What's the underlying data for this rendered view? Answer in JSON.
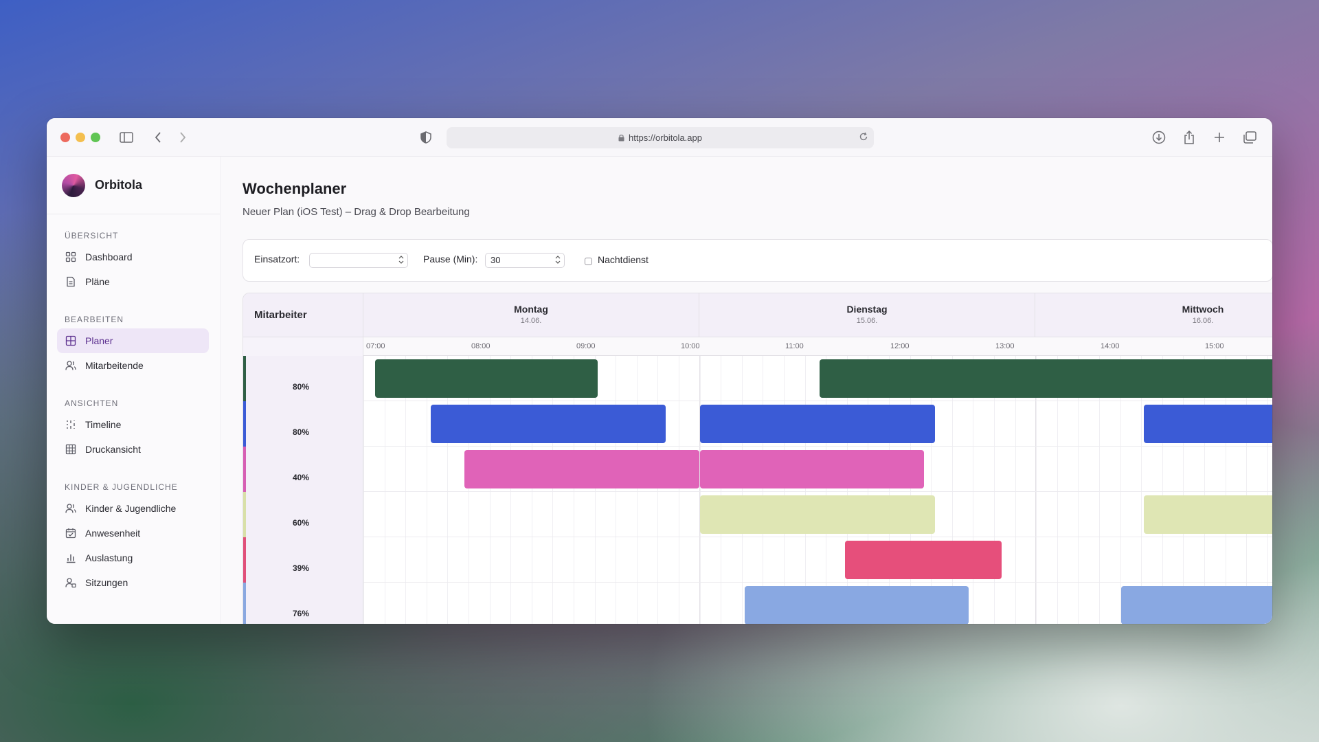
{
  "browser": {
    "url": "https://orbitola.app"
  },
  "brand": {
    "name": "Orbitola"
  },
  "sidebar": {
    "sections": [
      {
        "label": "ÜBERSICHT",
        "items": [
          {
            "label": "Dashboard",
            "icon": "grid-icon"
          },
          {
            "label": "Pläne",
            "icon": "document-icon"
          }
        ]
      },
      {
        "label": "BEARBEITEN",
        "items": [
          {
            "label": "Planer",
            "icon": "grid-icon",
            "active": true
          },
          {
            "label": "Mitarbeitende",
            "icon": "users-icon"
          }
        ]
      },
      {
        "label": "ANSICHTEN",
        "items": [
          {
            "label": "Timeline",
            "icon": "timeline-icon"
          },
          {
            "label": "Druckansicht",
            "icon": "table-icon"
          }
        ]
      },
      {
        "label": "KINDER & JUGENDLICHE",
        "items": [
          {
            "label": "Kinder & Jugendliche",
            "icon": "users-icon"
          },
          {
            "label": "Anwesenheit",
            "icon": "calendar-check-icon"
          },
          {
            "label": "Auslastung",
            "icon": "bar-chart-icon"
          },
          {
            "label": "Sitzungen",
            "icon": "user-session-icon"
          }
        ]
      }
    ]
  },
  "page": {
    "title": "Wochenplaner",
    "subtitle": "Neuer Plan (iOS Test) – Drag & Drop Bearbeitung"
  },
  "filters": {
    "einsatzort_label": "Einsatzort:",
    "einsatzort_value": "",
    "pause_label": "Pause (Min):",
    "pause_value": "30",
    "nachtdienst_label": "Nachtdienst"
  },
  "grid": {
    "header_label": "Mitarbeiter",
    "days": [
      {
        "name": "Montag",
        "date": "14.06."
      },
      {
        "name": "Dienstag",
        "date": "15.06."
      },
      {
        "name": "Mittwoch",
        "date": "16.06."
      }
    ],
    "times": [
      "07:00",
      "08:00",
      "09:00",
      "10:00",
      "11:00",
      "12:00",
      "13:00",
      "14:00",
      "15:00"
    ],
    "employees": [
      {
        "name": "",
        "hours": "",
        "percent": "80%",
        "color": "#2f5f45"
      },
      {
        "name": "",
        "hours": "",
        "percent": "80%",
        "color": "#3b5bd6"
      },
      {
        "name": "",
        "hours": "",
        "percent": "40%",
        "color": "#d65fb4"
      },
      {
        "name": "",
        "hours": "",
        "percent": "60%",
        "color": "#d8e0a8"
      },
      {
        "name": "",
        "hours": "",
        "percent": "39%",
        "color": "#e0507a"
      },
      {
        "name": "",
        "hours": "",
        "percent": "76%",
        "color": "#8aa8e0"
      }
    ],
    "shifts": [
      {
        "row": 0,
        "label": "",
        "color": "#2f5f45",
        "text_color": "#ffffff"
      },
      {
        "row": 0,
        "label": "",
        "color": "#2f5f45",
        "text_color": "#ffffff"
      },
      {
        "row": 0,
        "label": "",
        "color": "#2f5f45",
        "text_color": "#ffffff"
      },
      {
        "row": 1,
        "label": "",
        "color": "#3b5bd6",
        "text_color": "#ffffff"
      },
      {
        "row": 1,
        "label": "",
        "color": "#3b5bd6",
        "text_color": "#ffffff"
      },
      {
        "row": 1,
        "label": "",
        "color": "#3b5bd6",
        "text_color": "#ffffff"
      },
      {
        "row": 2,
        "label": "",
        "color": "#e063b8",
        "text_color": "#ffffff"
      },
      {
        "row": 2,
        "label": "",
        "color": "#e063b8",
        "text_color": "#ffffff"
      },
      {
        "row": 3,
        "label": "",
        "color": "#dfe6b4",
        "text_color": "#ffffff"
      },
      {
        "row": 3,
        "label": "",
        "color": "#dfe6b4",
        "text_color": "#ffffff"
      },
      {
        "row": 4,
        "label": "",
        "color": "#e64f7b",
        "text_color": "#ffffff"
      },
      {
        "row": 5,
        "label": "",
        "color": "#89a8e2",
        "text_color": "#ffffff"
      },
      {
        "row": 5,
        "label": "",
        "color": "#89a8e2",
        "text_color": "#ffffff"
      }
    ]
  }
}
